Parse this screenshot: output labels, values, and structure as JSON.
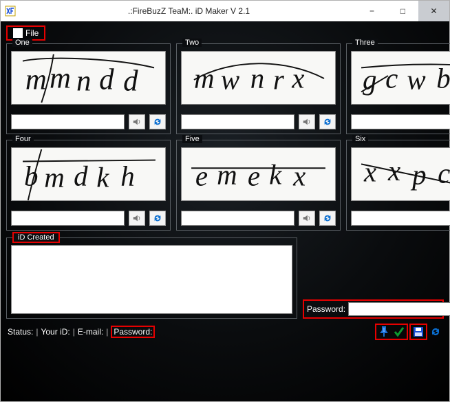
{
  "window": {
    "title": ".:FireBuzZ TeaM:.  iD Maker V 2.1",
    "min": "−",
    "max": "□",
    "close": "✕"
  },
  "menu": {
    "file": "File"
  },
  "captchas": [
    {
      "legend": "One",
      "value": "",
      "text": "mmndd"
    },
    {
      "legend": "Two",
      "value": "",
      "text": "mwnrx"
    },
    {
      "legend": "Three",
      "value": "",
      "text": "gcwbm"
    },
    {
      "legend": "Four",
      "value": "",
      "text": "bmdkh"
    },
    {
      "legend": "Five",
      "value": "",
      "text": "emekx"
    },
    {
      "legend": "Six",
      "value": "",
      "text": "xxpcx"
    }
  ],
  "idcreated": {
    "legend": "iD Created"
  },
  "password": {
    "label": "Password:",
    "value": ""
  },
  "status": {
    "status_lbl": "Status:",
    "yourid_lbl": "Your iD:",
    "email_lbl": "E-mail:",
    "password_lbl": "Password:",
    "sep": "|"
  }
}
